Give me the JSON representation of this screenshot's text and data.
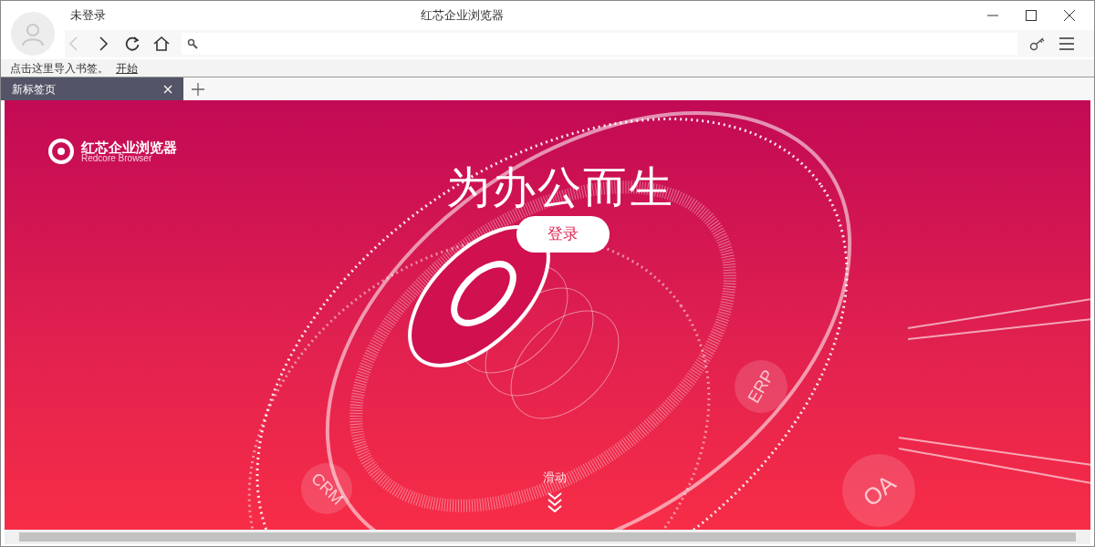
{
  "window": {
    "title": "红芯企业浏览器"
  },
  "user": {
    "status": "未登录"
  },
  "nav": {
    "back_disabled": true
  },
  "bookmarks_bar": {
    "hint": "点击这里导入书签。",
    "link": "开始"
  },
  "tabs": [
    {
      "label": "新标签页",
      "selected": true
    }
  ],
  "page": {
    "logo_name": "红芯企业浏览器",
    "logo_subtitle": "Redcore Browser",
    "slogan": "为办公而生",
    "login_button": "登录",
    "badges": [
      {
        "label": "ERP"
      },
      {
        "label": "CRM"
      },
      {
        "label": "OA"
      }
    ],
    "scroll_hint": "滑动"
  }
}
